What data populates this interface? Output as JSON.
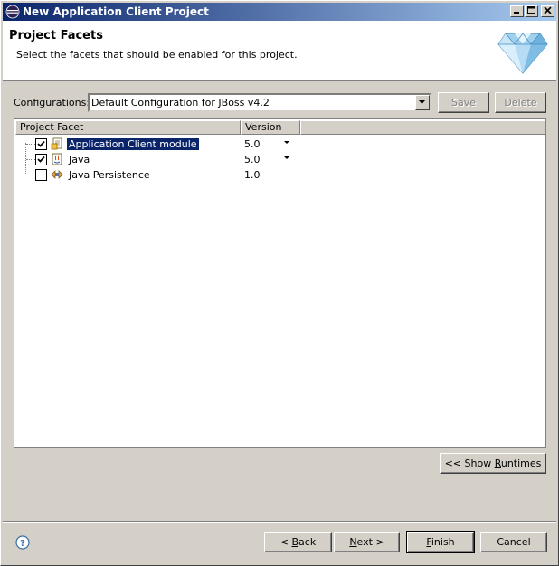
{
  "window": {
    "title": "New Application Client Project"
  },
  "banner": {
    "title": "Project Facets",
    "description": "Select the facets that should be enabled for this project."
  },
  "config": {
    "label": "Configurations:",
    "selected": "Default Configuration for JBoss v4.2",
    "save_label": "Save",
    "delete_label": "Delete"
  },
  "table": {
    "columns": [
      "Project Facet",
      "Version"
    ],
    "rows": [
      {
        "name": "Application Client module",
        "version": "5.0",
        "checked": true,
        "selected": true,
        "has_dropdown": true
      },
      {
        "name": "Java",
        "version": "5.0",
        "checked": true,
        "selected": false,
        "has_dropdown": true
      },
      {
        "name": "Java Persistence",
        "version": "1.0",
        "checked": false,
        "selected": false,
        "has_dropdown": false
      }
    ]
  },
  "buttons": {
    "show_runtimes_pre": "<< Show ",
    "show_runtimes_mn": "R",
    "show_runtimes_post": "untimes",
    "back_pre": "< ",
    "back_mn": "B",
    "back_post": "ack",
    "next_mn": "N",
    "next_post": "ext >",
    "finish_mn": "F",
    "finish_post": "inish",
    "cancel": "Cancel"
  },
  "colors": {
    "title_start": "#0a246a",
    "title_end": "#a6caf0",
    "selection": "#0a246a",
    "dialog": "#d4d0c8"
  }
}
